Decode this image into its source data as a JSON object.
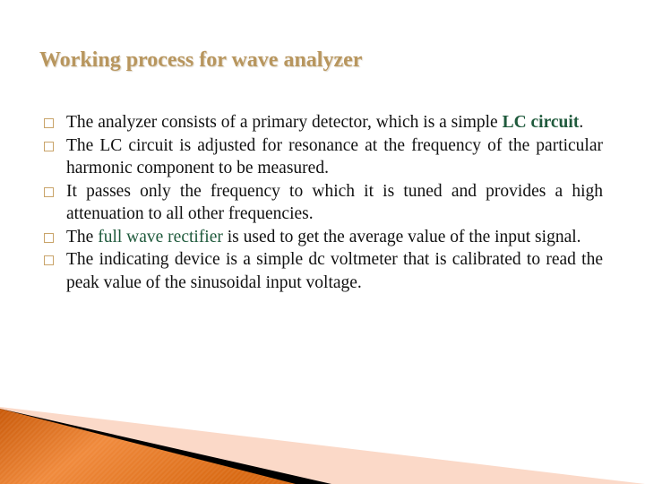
{
  "slide": {
    "title": "Working process for wave analyzer",
    "bullets": [
      {
        "before": "The analyzer consists of a primary detector, which is a simple ",
        "highlight": "LC circuit",
        "after": "."
      },
      {
        "before": "The LC circuit is adjusted for resonance at the frequency of the particular harmonic component to be measured.",
        "highlight": "",
        "after": ""
      },
      {
        "before": "It passes only the frequency to which it is tuned and provides a high attenuation to all other frequencies.",
        "highlight": "",
        "after": ""
      },
      {
        "before": "The ",
        "highlight": "full wave rectifier",
        "after": " is used to get the average value of the input signal."
      },
      {
        "before": "The indicating device is a simple dc voltmeter that is calibrated to read the peak value of the sinusoidal input voltage.",
        "highlight": "",
        "after": ""
      }
    ],
    "colors": {
      "title": "#b8965e",
      "highlight": "#1f5a3c",
      "bullet_box": "#c9a46a",
      "accent_orange": "#e8731c"
    }
  }
}
